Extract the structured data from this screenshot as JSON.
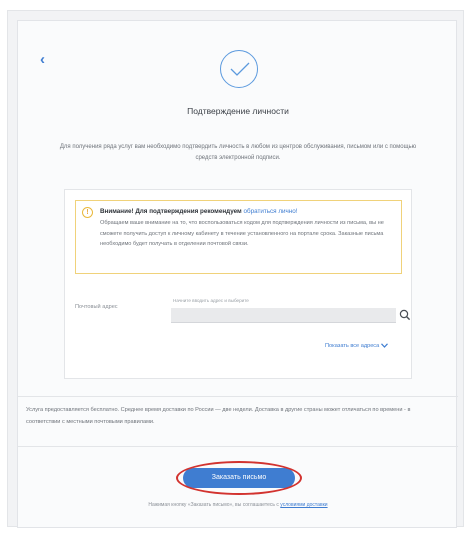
{
  "header": {
    "back_symbol": "‹",
    "title": "Подтверждение личности"
  },
  "description": "Для получения ряда услуг вам необходимо подтвердить личность в любом из центров обслуживания, письмом или с помощью средств электронной подписи.",
  "warning": {
    "icon_symbol": "!",
    "heading": "Внимание! Для подтверждения рекомендуем",
    "heading_link": "обратиться лично!",
    "body": "Обращаем ваше внимание на то, что воспользоваться кодом для подтверждения личности из письма, вы не сможете получить доступ к личному кабинету в течение установленного на портале срока. Заказные письма необходимо будет получать в отделении почтовой связи."
  },
  "address": {
    "label": "Почтовый адрес",
    "caption": "Начните вводить адрес и выберите",
    "value": "",
    "show_all": "Показать все адреса"
  },
  "info": "Услуга предоставляется бесплатно. Среднее время доставки по России — две недели. Доставка в другие страны может отличаться по времени - в соответствии с местными почтовыми правилами.",
  "order_button": "Заказать письмо",
  "footer": {
    "text": "Нажимая кнопку «Заказать письмо», вы соглашаетесь с",
    "link": "условиями доставки"
  },
  "colors": {
    "accent": "#3f7dd1",
    "warning_border": "#f0d27a",
    "highlight_ring": "#d2332f"
  }
}
